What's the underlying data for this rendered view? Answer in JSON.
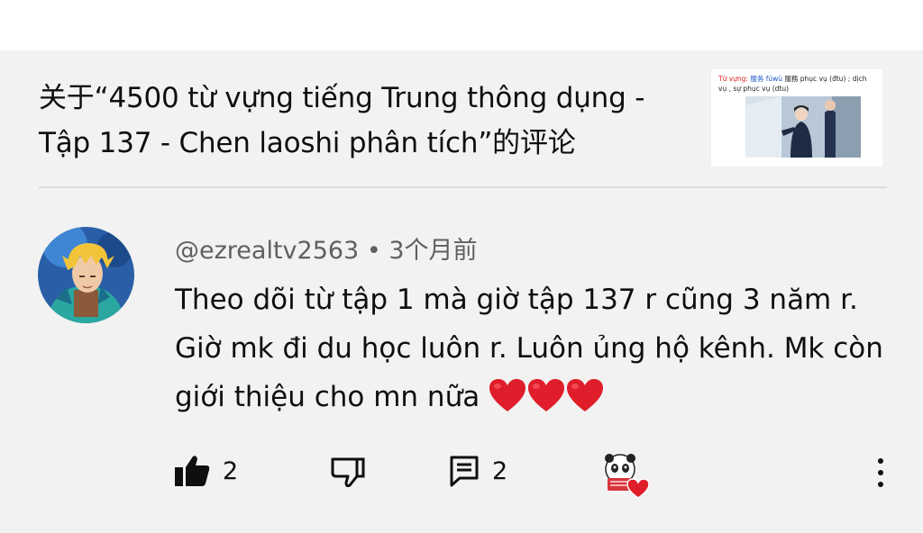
{
  "header": {
    "title": "关于“4500 từ vựng tiếng Trung thông dụng - Tập 137 - Chen laoshi phân tích”的评论",
    "thumbnail": {
      "caption_label": "Từ vựng:",
      "caption_zh": "服务 fúwù",
      "caption_rest": "服務 phục vụ (đtu) ; dịch vụ , sự phục vụ (dtu)"
    }
  },
  "comment": {
    "author": "@ezrealtv2563",
    "separator": " • ",
    "time": "3个月前",
    "text": "Theo dõi từ tập 1 mà giờ tập 137 r cũng 3 năm r. Giờ mk đi du học luôn r. Luôn ủng hộ kênh. Mk còn giới thiệu cho mn nữa"
  },
  "actions": {
    "like_count": "2",
    "reply_count": "2",
    "icons": [
      "thumbs-up-icon",
      "thumbs-down-icon",
      "reply-icon",
      "creator-heart-icon",
      "more-vert-icon"
    ]
  },
  "colors": {
    "panel_bg": "#f2f2f2",
    "meta_text": "#606060",
    "heart_red": "#e01e2b"
  }
}
